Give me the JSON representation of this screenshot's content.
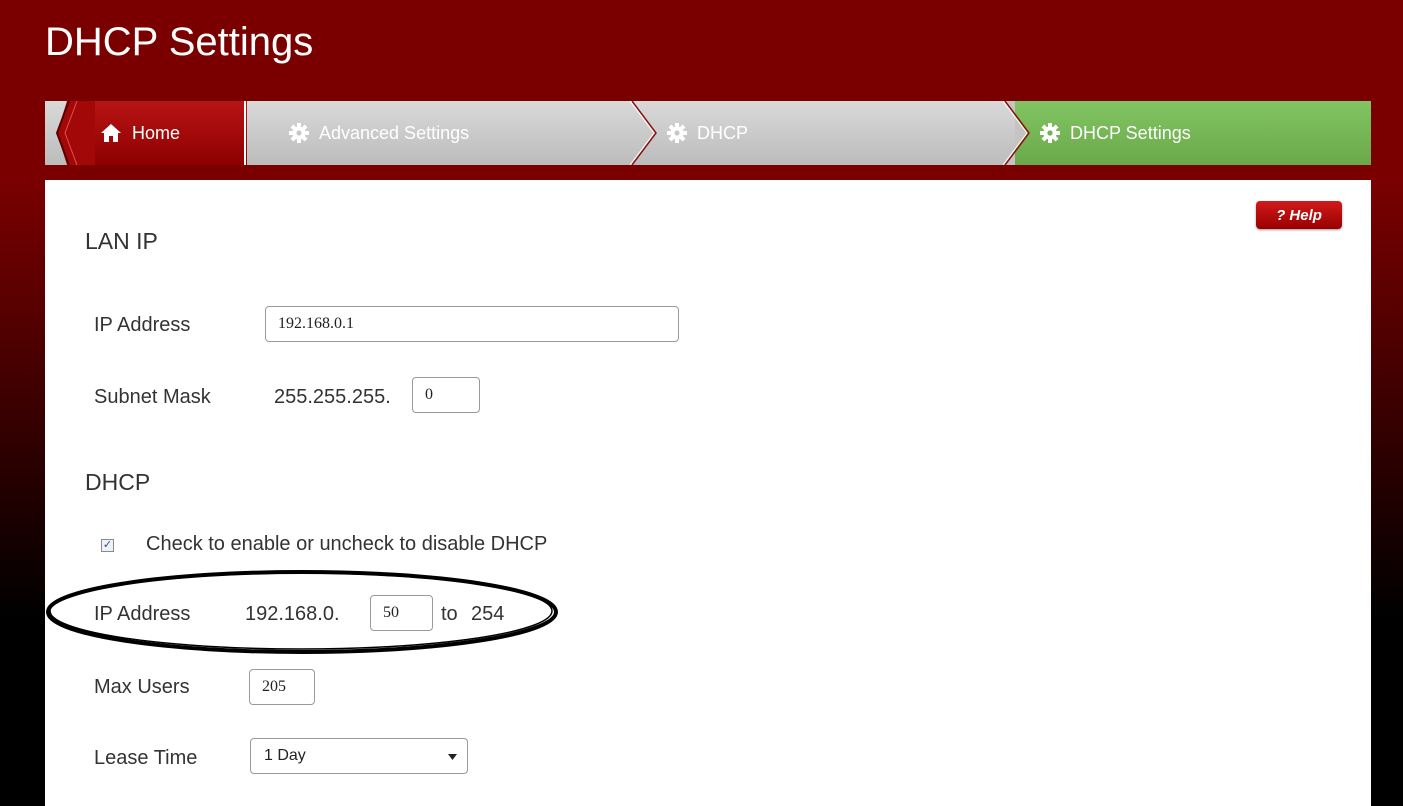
{
  "page": {
    "title": "DHCP Settings"
  },
  "breadcrumb": {
    "items": [
      {
        "label": "Home",
        "icon": "home-icon"
      },
      {
        "label": "Advanced Settings",
        "icon": "gear-icon"
      },
      {
        "label": "DHCP",
        "icon": "gear-icon"
      },
      {
        "label": "DHCP Settings",
        "icon": "gear-icon"
      }
    ]
  },
  "help": {
    "label": "? Help"
  },
  "lan": {
    "section_title": "LAN IP",
    "ip_label": "IP Address",
    "ip_value": "192.168.0.1",
    "subnet_label": "Subnet Mask",
    "subnet_prefix": "255.255.255.",
    "subnet_value": "0"
  },
  "dhcp": {
    "section_title": "DHCP",
    "enable_checked": true,
    "enable_label": "Check to enable or uncheck to disable DHCP",
    "ip_label": "IP Address",
    "ip_prefix": "192.168.0.",
    "ip_start": "50",
    "to_label": "to",
    "ip_end": "254",
    "max_users_label": "Max Users",
    "max_users_value": "205",
    "lease_label": "Lease Time",
    "lease_value": "1 Day"
  },
  "colors": {
    "header_red": "#7a0000",
    "crumb_green": "#6aa94b",
    "help_red": "#c00000"
  }
}
